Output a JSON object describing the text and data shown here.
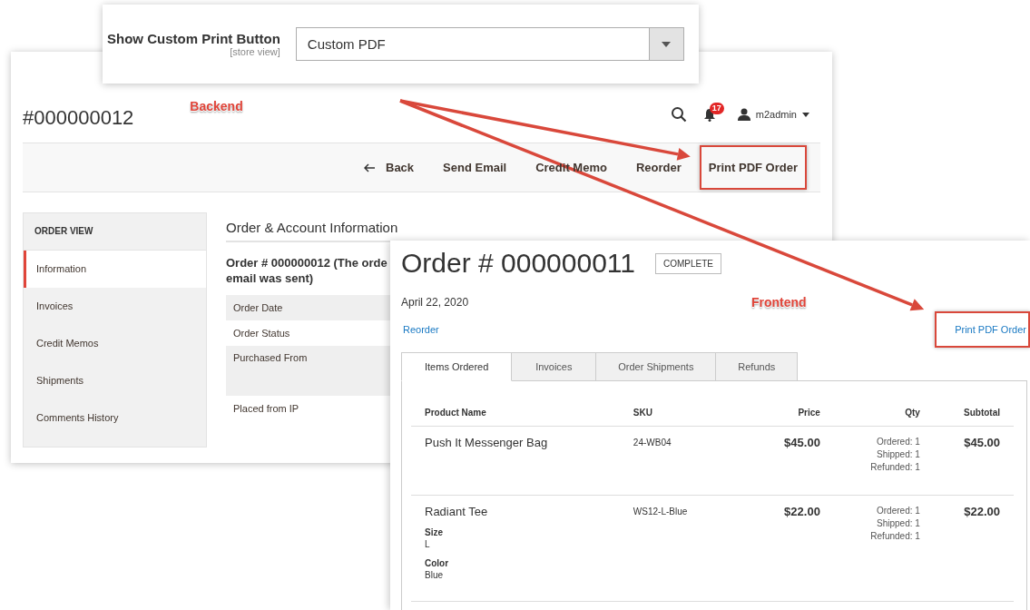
{
  "settings_panel": {
    "label": "Show Custom Print Button",
    "scope": "[store view]",
    "select_value": "Custom PDF"
  },
  "backend": {
    "order_title": "#000000012",
    "annotation": "Backend",
    "notification_count": "17",
    "user": "m2admin",
    "actions": [
      {
        "label": "Back",
        "kind": "back",
        "highlighted": false
      },
      {
        "label": "Send Email",
        "kind": "text",
        "highlighted": false
      },
      {
        "label": "Credit Memo",
        "kind": "text",
        "highlighted": false
      },
      {
        "label": "Reorder",
        "kind": "text",
        "highlighted": false
      },
      {
        "label": "Print PDF Order",
        "kind": "text",
        "highlighted": true
      }
    ],
    "sidebar": {
      "title": "ORDER VIEW",
      "items": [
        {
          "label": "Information",
          "selected": true
        },
        {
          "label": "Invoices",
          "selected": false
        },
        {
          "label": "Credit Memos",
          "selected": false
        },
        {
          "label": "Shipments",
          "selected": false
        },
        {
          "label": "Comments History",
          "selected": false
        }
      ]
    },
    "section_title": "Order & Account Information",
    "order_heading_lines": [
      "Order # 000000012 (The orde",
      "email was sent)"
    ],
    "info_rows": [
      {
        "label": "Order Date",
        "kind": "short"
      },
      {
        "label": "Order Status",
        "kind": "short"
      },
      {
        "label": "Purchased From",
        "kind": "tall"
      },
      {
        "label": "Placed from IP",
        "kind": "short"
      }
    ]
  },
  "frontend": {
    "order_title": "Order # 000000011",
    "annotation": "Frontend",
    "status": "COMPLETE",
    "date": "April 22, 2020",
    "links": [
      {
        "label": "Reorder",
        "highlighted": false
      },
      {
        "label": "Print PDF Order",
        "highlighted": true
      }
    ],
    "tabs": [
      {
        "label": "Items Ordered",
        "selected": true
      },
      {
        "label": "Invoices",
        "selected": false
      },
      {
        "label": "Order Shipments",
        "selected": false
      },
      {
        "label": "Refunds",
        "selected": false
      }
    ],
    "table": {
      "columns": [
        "Product Name",
        "SKU",
        "Price",
        "Qty",
        "Subtotal"
      ],
      "rows": [
        {
          "product": "Push It Messenger Bag",
          "sku": "24-WB04",
          "price": "$45.00",
          "qty": [
            "Ordered: 1",
            "Shipped: 1",
            "Refunded: 1"
          ],
          "subtotal": "$45.00"
        },
        {
          "product": "Radiant Tee",
          "options": [
            {
              "label": "Size",
              "value": "L"
            },
            {
              "label": "Color",
              "value": "Blue"
            }
          ],
          "sku": "WS12-L-Blue",
          "price": "$22.00",
          "qty": [
            "Ordered: 1",
            "Shipped: 1",
            "Refunded: 1"
          ],
          "subtotal": "$22.00"
        }
      ]
    }
  }
}
